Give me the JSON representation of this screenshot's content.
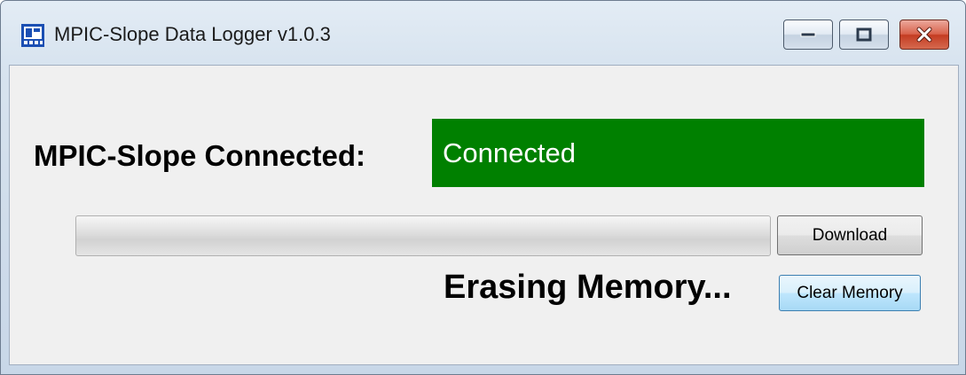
{
  "window": {
    "title": "MPIC-Slope Data Logger  v1.0.3",
    "icon": "app-icon",
    "controls": {
      "minimize_icon": "minimize-icon",
      "maximize_icon": "maximize-icon",
      "close_icon": "close-icon"
    }
  },
  "status": {
    "label": "MPIC-Slope Connected:",
    "value": "Connected",
    "color": "#008000"
  },
  "progress": {
    "value": 0,
    "fill_color": "#06b025"
  },
  "buttons": {
    "download": "Download",
    "clear_memory": "Clear Memory"
  },
  "message": "Erasing Memory..."
}
